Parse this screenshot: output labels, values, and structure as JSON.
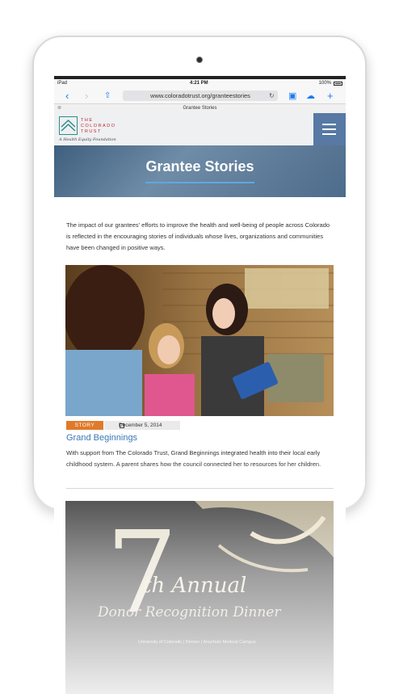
{
  "status_bar": {
    "device": "iPad",
    "time": "4:21 PM",
    "battery": "100%"
  },
  "browser": {
    "url": "www.coloradotrust.org/granteestories",
    "tab_title": "Grantee Stories",
    "icons": [
      "back-icon",
      "forward-icon",
      "share-icon",
      "reload-icon",
      "reader-icon",
      "cloud-icon",
      "add-icon"
    ]
  },
  "site": {
    "logo_name": "THE\nCOLORADO\nTRUST",
    "logo_tagline": "A Health Equity Foundation",
    "menu_icon": "hamburger-icon"
  },
  "hero": {
    "title": "Grantee Stories"
  },
  "intro": "The impact of our grantees' efforts to improve the health and well-being of people across Colorado is reflected in the encouraging stories of individuals whose lives, organizations and communities have been changed in positive ways.",
  "stories": [
    {
      "badge": "STORY",
      "date": "December 5, 2014",
      "title": "Grand Beginnings",
      "description": "With support from The Colorado Trust, Grand Beginnings integrated health into their local early childhood system. A parent shares how the council connected her to resources for her children."
    },
    {
      "image_number": "7",
      "image_line1": "th Annual",
      "image_line2": "Donor Recognition Dinner",
      "image_footer": "University of Colorado | Denver | Anschutz Medical Campus"
    }
  ],
  "colors": {
    "accent": "#5779a3",
    "link": "#3a78b8",
    "badge": "#e07a2a",
    "logo_red": "#c2272d",
    "logo_teal": "#2f8c86"
  }
}
